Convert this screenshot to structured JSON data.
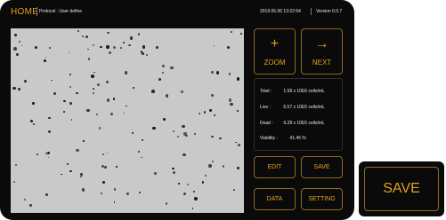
{
  "header": {
    "home_label": "HOME",
    "protocol_text": "Protocol : User define",
    "datetime": "2019.05.06 13:22:54",
    "version": "Version 0.0.7"
  },
  "buttons": {
    "zoom": {
      "glyph": "+",
      "label": "ZOOM"
    },
    "next": {
      "glyph": "→",
      "label": "NEXT"
    },
    "edit": "EDIT",
    "save": "SAVE",
    "data": "DATA",
    "setting": "SETTING"
  },
  "results": {
    "total_label": "Total :",
    "total_value": "1.58 x 10E6 cells/mL",
    "live_label": "Live :",
    "live_value": "6.57 x 10E5 cells/mL",
    "dead_label": "Dead :",
    "dead_value": "9.28 x 10E5 cells/mL",
    "viability_label": "Viability :",
    "viability_value": "41.46 %"
  },
  "save_zoom_label": "SAVE",
  "colors": {
    "accent": "#e3a21a",
    "device_bg": "#0a0a0a",
    "image_bg": "#c9c9c9"
  }
}
